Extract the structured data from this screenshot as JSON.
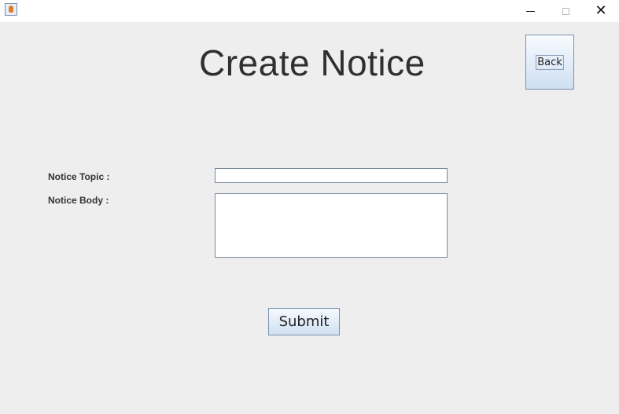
{
  "window": {
    "title": "",
    "minimize_icon": "minimize-icon",
    "maximize_icon": "maximize-icon",
    "close_icon": "close-icon",
    "close_glyph": "✕"
  },
  "page": {
    "title": "Create Notice"
  },
  "header": {
    "back_label": "Back"
  },
  "form": {
    "topic_label": "Notice Topic :",
    "topic_value": "",
    "topic_placeholder": "",
    "body_label": "Notice Body :",
    "body_value": "",
    "body_placeholder": "",
    "submit_label": "Submit"
  },
  "colors": {
    "background": "#eeeeee",
    "button_border": "#7a90ad",
    "button_gradient_top": "#f6faff",
    "button_gradient_bottom": "#cfe0f1",
    "title_text": "#303030"
  }
}
